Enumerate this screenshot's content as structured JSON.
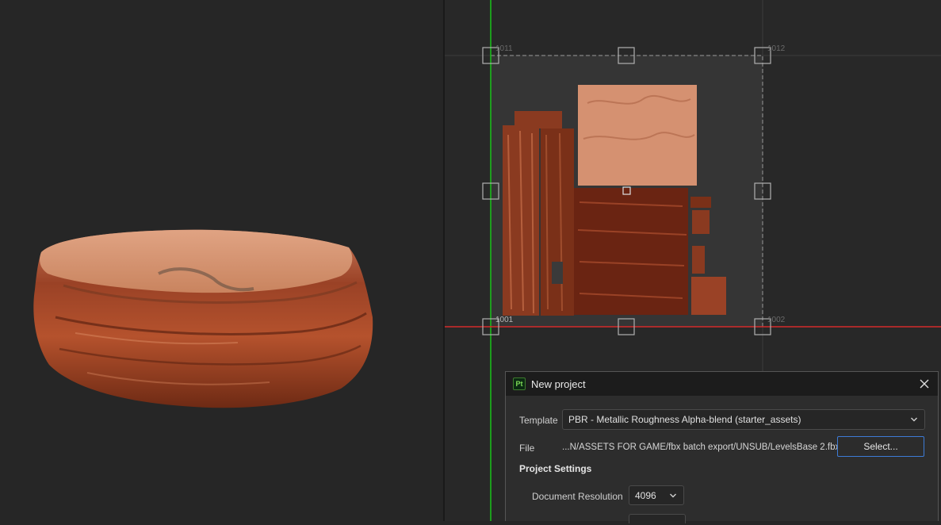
{
  "uv_tiles": {
    "top_left": "1011",
    "top_right": "1012",
    "bottom_left": "1001",
    "bottom_right": "1002"
  },
  "dialog": {
    "title": "New project",
    "app_icon_text": "Pt",
    "template_label": "Template",
    "template_value": "PBR - Metallic Roughness Alpha-blend (starter_assets)",
    "file_label": "File",
    "file_path": "...N/ASSETS FOR GAME/fbx batch export/UNSUB/LevelsBase 2.fbx",
    "select_button": "Select...",
    "project_settings_title": "Project Settings",
    "doc_resolution_label": "Document Resolution",
    "doc_resolution_value": "4096"
  },
  "colors": {
    "axis_v": "#19c419",
    "axis_h": "#d42a2a",
    "accent": "#3d7bd6"
  }
}
